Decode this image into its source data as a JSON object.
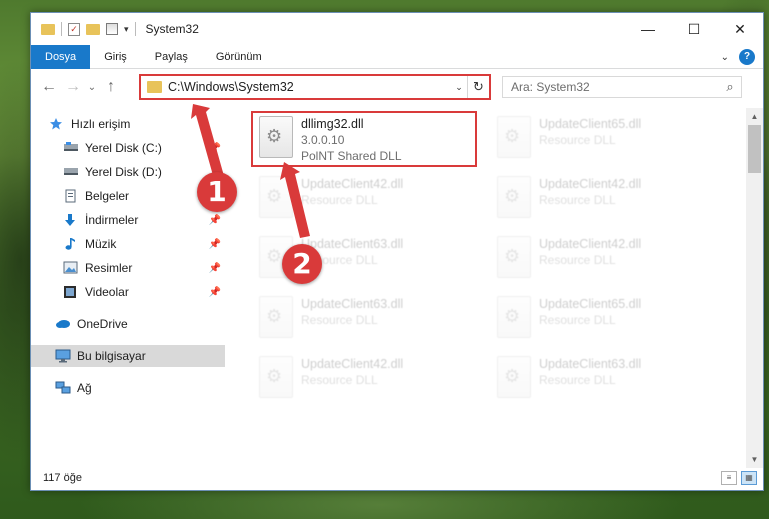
{
  "window": {
    "title": "System32",
    "controls": {
      "minimize": "—",
      "maximize": "☐",
      "close": "✕"
    }
  },
  "ribbon": {
    "tabs": [
      "Dosya",
      "Giriş",
      "Paylaş",
      "Görünüm"
    ],
    "help": "?"
  },
  "navbar": {
    "address": "C:\\Windows\\System32",
    "search_placeholder": "Ara: System32"
  },
  "sidebar": {
    "items": [
      {
        "label": "Hızlı erişim",
        "icon": "star-icon"
      },
      {
        "label": "Yerel Disk (C:)",
        "icon": "disk-icon"
      },
      {
        "label": "Yerel Disk (D:)",
        "icon": "disk-icon"
      },
      {
        "label": "Belgeler",
        "icon": "documents-icon"
      },
      {
        "label": "İndirmeler",
        "icon": "download-icon"
      },
      {
        "label": "Müzik",
        "icon": "music-icon"
      },
      {
        "label": "Resimler",
        "icon": "pictures-icon"
      },
      {
        "label": "Videolar",
        "icon": "video-icon"
      },
      {
        "label": "OneDrive",
        "icon": "cloud-icon"
      },
      {
        "label": "Bu bilgisayar",
        "icon": "computer-icon"
      },
      {
        "label": "Ağ",
        "icon": "network-icon"
      }
    ]
  },
  "files": [
    {
      "name": "dllimg32.dll",
      "line2": "3.0.0.10",
      "line3": "PolNT Shared DLL"
    },
    {
      "name": "UpdateClient65.dll",
      "line2": "Resource DLL"
    },
    {
      "name": "UpdateClient42.dll",
      "line2": "Resource DLL"
    },
    {
      "name": "UpdateClient42.dll",
      "line2": "Resource DLL"
    },
    {
      "name": "UpdateClient63.dll",
      "line2": "Resource DLL"
    },
    {
      "name": "UpdateClient42.dll",
      "line2": "Resource DLL"
    },
    {
      "name": "UpdateClient63.dll",
      "line2": "Resource DLL"
    },
    {
      "name": "UpdateClient65.dll",
      "line2": "Resource DLL"
    },
    {
      "name": "UpdateClient42.dll",
      "line2": "Resource DLL"
    },
    {
      "name": "UpdateClient63.dll",
      "line2": "Resource DLL"
    }
  ],
  "status": {
    "count": "117 öğe"
  },
  "annotations": {
    "one": "1",
    "two": "2",
    "color": "#d93a3a"
  }
}
